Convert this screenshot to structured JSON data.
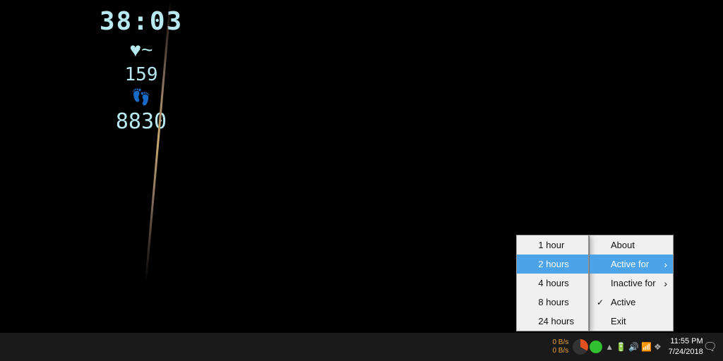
{
  "background": {
    "color": "#000000"
  },
  "device_display": {
    "time": "38:03",
    "heart_icon": "♥",
    "heart_rate": "159",
    "feet_icon": "👣",
    "steps": "8830"
  },
  "context_menu_main": {
    "items": [
      {
        "id": "about",
        "label": "About",
        "type": "normal"
      },
      {
        "id": "active-for",
        "label": "Active for",
        "type": "submenu"
      },
      {
        "id": "inactive-for",
        "label": "Inactive for",
        "type": "submenu"
      },
      {
        "id": "active",
        "label": "Active",
        "type": "checked",
        "checked": true
      },
      {
        "id": "exit",
        "label": "Exit",
        "type": "normal"
      }
    ]
  },
  "hours_menu": {
    "items": [
      {
        "id": "1hour",
        "label": "1 hour",
        "selected": false
      },
      {
        "id": "2hours",
        "label": "2 hours",
        "selected": true
      },
      {
        "id": "4hours",
        "label": "4 hours",
        "selected": false
      },
      {
        "id": "8hours",
        "label": "8 hours",
        "selected": false
      },
      {
        "id": "24hours",
        "label": "24 hours",
        "selected": false
      }
    ]
  },
  "taskbar": {
    "network_up": "0 B/s",
    "network_down": "0 B/s",
    "time": "11:55 PM",
    "date": "7/24/2018"
  }
}
